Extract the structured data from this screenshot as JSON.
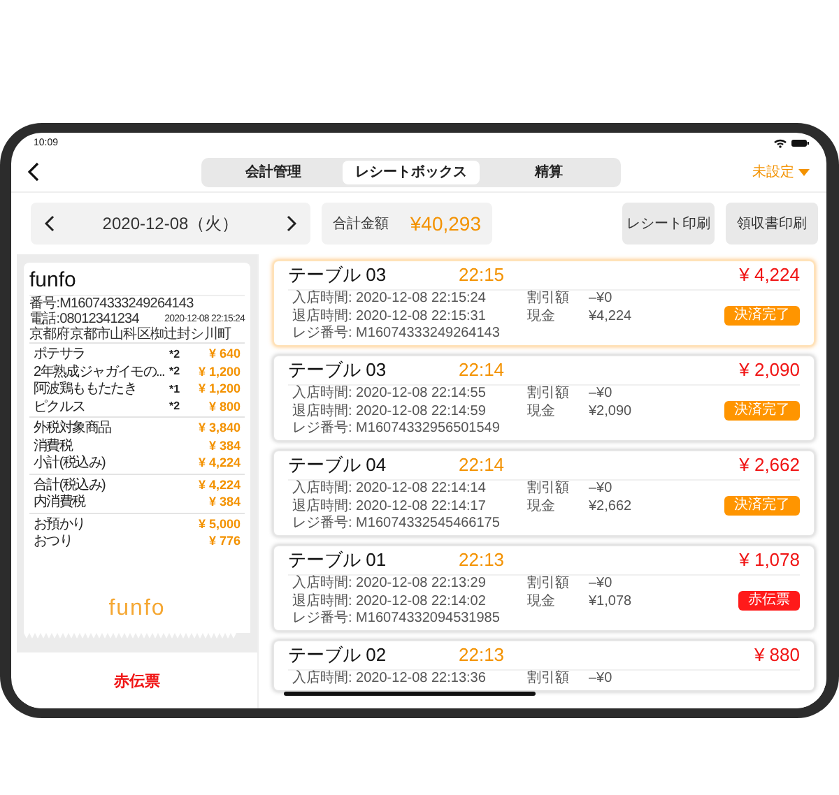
{
  "status_bar": {
    "time": "10:09"
  },
  "nav": {
    "tabs": [
      {
        "label": "会計管理",
        "selected": false
      },
      {
        "label": "レシートボックス",
        "selected": true
      },
      {
        "label": "精算",
        "selected": false
      }
    ],
    "store_selector": "未設定"
  },
  "toolbar": {
    "date": "2020-12-08（火）",
    "total_label": "合計金額",
    "total": "¥40,293",
    "buttons": [
      "レシート印刷",
      "領収書印刷"
    ]
  },
  "receipt": {
    "shop": "funfo",
    "number": "番号:M16074333249264143",
    "phone": "電話:08012341234",
    "datetime": "2020-12-08 22:15:24",
    "address": "京都府京都市山科区椥辻封シ川町",
    "items": [
      {
        "name": "ポテサラ",
        "qty": "*2",
        "price": "¥ 640"
      },
      {
        "name": "2年熟成ジャガイモの...",
        "qty": "*2",
        "price": "¥ 1,200"
      },
      {
        "name": "阿波鶏ももたたき",
        "qty": "*1",
        "price": "¥ 1,200"
      },
      {
        "name": "ピクルス",
        "qty": "*2",
        "price": "¥ 800"
      }
    ],
    "summary": [
      [
        {
          "label": "外税対象商品",
          "value": "¥ 3,840"
        },
        {
          "label": "消費税",
          "value": "¥ 384"
        },
        {
          "label": "小計(税込み)",
          "value": "¥ 4,224"
        }
      ],
      [
        {
          "label": "合計(税込み)",
          "value": "¥ 4,224"
        },
        {
          "label": "内消費税",
          "value": "¥ 384"
        }
      ],
      [
        {
          "label": "お預かり",
          "value": "¥ 5,000"
        },
        {
          "label": "おつり",
          "value": "¥ 776"
        }
      ]
    ],
    "footer_logo": "funfo",
    "action": "赤伝票"
  },
  "cards": [
    {
      "title": "テーブル 03",
      "time": "22:15",
      "amount": "¥ 4,224",
      "selected": true,
      "in": "入店時間: 2020-12-08 22:15:24",
      "out": "退店時間: 2020-12-08 22:15:31",
      "register": "レジ番号: M16074333249264143",
      "discount_label": "割引額",
      "discount": "–¥0",
      "pay_label": "現金",
      "pay": "¥4,224",
      "badge": {
        "kind": "done",
        "label": "決済完了"
      }
    },
    {
      "title": "テーブル 03",
      "time": "22:14",
      "amount": "¥ 2,090",
      "selected": false,
      "in": "入店時間: 2020-12-08 22:14:55",
      "out": "退店時間: 2020-12-08 22:14:59",
      "register": "レジ番号: M16074332956501549",
      "discount_label": "割引額",
      "discount": "–¥0",
      "pay_label": "現金",
      "pay": "¥2,090",
      "badge": {
        "kind": "done",
        "label": "決済完了"
      }
    },
    {
      "title": "テーブル 04",
      "time": "22:14",
      "amount": "¥ 2,662",
      "selected": false,
      "in": "入店時間: 2020-12-08 22:14:14",
      "out": "退店時間: 2020-12-08 22:14:17",
      "register": "レジ番号: M16074332545466175",
      "discount_label": "割引額",
      "discount": "–¥0",
      "pay_label": "現金",
      "pay": "¥2,662",
      "badge": {
        "kind": "done",
        "label": "決済完了"
      }
    },
    {
      "title": "テーブル 01",
      "time": "22:13",
      "amount": "¥ 1,078",
      "selected": false,
      "in": "入店時間: 2020-12-08 22:13:29",
      "out": "退店時間: 2020-12-08 22:14:02",
      "register": "レジ番号: M16074332094531985",
      "discount_label": "割引額",
      "discount": "–¥0",
      "pay_label": "現金",
      "pay": "¥1,078",
      "badge": {
        "kind": "void",
        "label": "赤伝票"
      }
    },
    {
      "title": "テーブル 02",
      "time": "22:13",
      "amount": "¥ 880",
      "selected": false,
      "in": "入店時間: 2020-12-08 22:13:36",
      "discount_label": "割引額",
      "discount": "–¥0"
    }
  ]
}
